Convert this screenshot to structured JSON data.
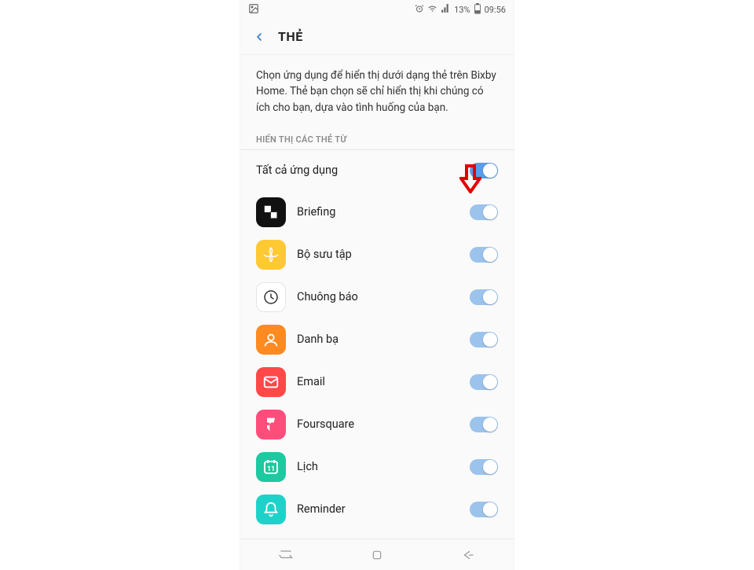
{
  "status": {
    "battery_pct": "13%",
    "time": "09:56"
  },
  "header": {
    "title": "THẺ"
  },
  "description": "Chọn ứng dụng để hiển thị dưới dạng thẻ trên Bixby Home. Thẻ bạn chọn sẽ chỉ hiển thị khi chúng có ích cho bạn, dựa vào tình huống của bạn.",
  "section_label": "HIỂN THỊ CÁC THẺ TỪ",
  "master": {
    "label": "Tất cả ứng dụng",
    "enabled": true
  },
  "apps": [
    {
      "id": "briefing",
      "label": "Briefing",
      "enabled": true,
      "icon_name": "briefing-icon"
    },
    {
      "id": "gallery",
      "label": "Bộ sưu tập",
      "enabled": true,
      "icon_name": "gallery-icon"
    },
    {
      "id": "alarm",
      "label": "Chuông báo",
      "enabled": true,
      "icon_name": "alarm-icon"
    },
    {
      "id": "contacts",
      "label": "Danh bạ",
      "enabled": true,
      "icon_name": "contacts-icon"
    },
    {
      "id": "email",
      "label": "Email",
      "enabled": true,
      "icon_name": "email-icon"
    },
    {
      "id": "foursquare",
      "label": "Foursquare",
      "enabled": true,
      "icon_name": "foursquare-icon"
    },
    {
      "id": "calendar",
      "label": "Lịch",
      "enabled": true,
      "icon_name": "calendar-icon"
    },
    {
      "id": "reminder",
      "label": "Reminder",
      "enabled": true,
      "icon_name": "reminder-icon"
    }
  ]
}
